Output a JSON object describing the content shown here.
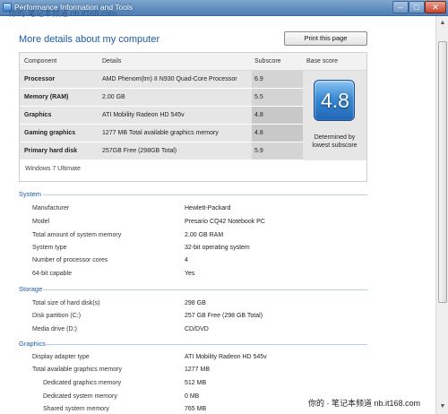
{
  "window": {
    "title": "Performance Information and Tools"
  },
  "watermarks": {
    "top": "你的·笔记本频道 nb.it168.com",
    "bottom": "你的 · 笔记本频道 nb.it168.com"
  },
  "header": {
    "heading": "More details about my computer",
    "print_label": "Print this page"
  },
  "score_table": {
    "columns": [
      "Component",
      "Details",
      "Subscore",
      "Base score"
    ],
    "rows": [
      {
        "component": "Processor",
        "details": "AMD Phenom(tm) II N930 Quad-Core Processor",
        "subscore": "6.9"
      },
      {
        "component": "Memory (RAM)",
        "details": "2.00 GB",
        "subscore": "5.5"
      },
      {
        "component": "Graphics",
        "details": "ATI Mobility Radeon HD 545v",
        "subscore": "4.8"
      },
      {
        "component": "Gaming graphics",
        "details": "1277 MB Total available graphics memory",
        "subscore": "4.8"
      },
      {
        "component": "Primary hard disk",
        "details": "257GB Free (298GB Total)",
        "subscore": "5.9"
      }
    ],
    "base_score": "4.8",
    "base_desc": "Determined by lowest subscore",
    "os": "Windows 7 Ultimate"
  },
  "system": {
    "title": "System",
    "items": [
      {
        "label": "Manufacturer",
        "value": "Hewlett-Packard"
      },
      {
        "label": "Model",
        "value": "Presario CQ42 Notebook PC"
      },
      {
        "label": "Total amount of system memory",
        "value": "2.00 GB RAM"
      },
      {
        "label": "System type",
        "value": "32-bit operating system"
      },
      {
        "label": "Number of processor cores",
        "value": "4"
      },
      {
        "label": "64-bit capable",
        "value": "Yes"
      }
    ]
  },
  "storage": {
    "title": "Storage",
    "items": [
      {
        "label": "Total size of hard disk(s)",
        "value": "298 GB"
      },
      {
        "label": "Disk partition (C:)",
        "value": "257 GB Free (298 GB Total)"
      },
      {
        "label": "Media drive (D:)",
        "value": "CD/DVD"
      }
    ]
  },
  "graphics": {
    "title": "Graphics",
    "items": [
      {
        "label": "Display adapter type",
        "value": "ATI Mobility Radeon HD 545v"
      },
      {
        "label": "Total available graphics memory",
        "value": "1277 MB"
      },
      {
        "label": "Dedicated graphics memory",
        "value": "512 MB"
      },
      {
        "label": "Dedicated system memory",
        "value": "0 MB"
      },
      {
        "label": "Shared system memory",
        "value": "765 MB"
      }
    ]
  }
}
